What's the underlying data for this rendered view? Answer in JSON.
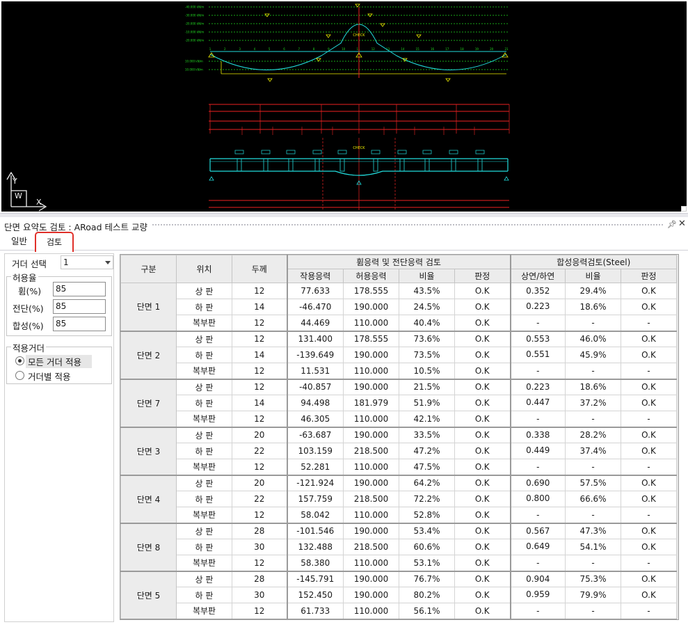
{
  "cad": {
    "loads": [
      "-40.000 kN/m",
      "-30.000 kN/m",
      "-20.000 kN/m",
      "-10.000 kN/m",
      "-20.000 kN/m",
      "10.000 kN/m",
      "10.000 kN/m"
    ],
    "check_top": "CHECK",
    "check_bottom": "CHECK",
    "node_numbers": [
      "1",
      "2",
      "3",
      "4",
      "5",
      "6",
      "7",
      "8",
      "9",
      "10",
      "11",
      "12",
      "13",
      "14",
      "15",
      "16",
      "17",
      "18",
      "19",
      "20",
      "21"
    ],
    "axis_x": "X",
    "axis_y": "Y",
    "axis_w": "W"
  },
  "panel": {
    "title": "단면 요약도 검토 : ARoad 테스트 교량",
    "pin_icon": "pin-icon",
    "close_icon": "close-icon"
  },
  "tabs": [
    {
      "label": "일반",
      "active": false
    },
    {
      "label": "검토",
      "active": true
    }
  ],
  "options": {
    "girder_select_label": "거더 선택",
    "girder_select_value": "1",
    "allow_group_label": "허용율",
    "bending_label": "휨(%)",
    "bending_value": "85",
    "shear_label": "전단(%)",
    "shear_value": "85",
    "composite_label": "합성(%)",
    "composite_value": "85",
    "apply_group_label": "적용거더",
    "radio_all": "모든 거더 적용",
    "radio_each": "거더별 적용",
    "radio_selected": "all"
  },
  "table": {
    "headers": {
      "group": "구분",
      "position": "위치",
      "thickness": "두께",
      "bending_group": "휨응력 및 전단응력 검토",
      "composite_group": "합성응력검토(Steel)",
      "applied_stress": "작용응력",
      "allowable_stress": "허용응력",
      "ratio": "비율",
      "judgement": "판정",
      "upper_lower": "상연/하연",
      "ratio2": "비율",
      "judgement2": "판정"
    },
    "sections": [
      {
        "name": "단면 1",
        "rows": [
          {
            "pos": "상 판",
            "t": "12",
            "applied": "77.633",
            "allow": "178.555",
            "ratio": "43.5%",
            "judge": "O.K",
            "ul": "0.352",
            "ratio2": "29.4%",
            "judge2": "O.K"
          },
          {
            "pos": "하 판",
            "t": "14",
            "applied": "-46.470",
            "allow": "190.000",
            "ratio": "24.5%",
            "judge": "O.K",
            "ul": "0.223",
            "ratio2": "18.6%",
            "judge2": "O.K"
          },
          {
            "pos": "복부판",
            "t": "12",
            "applied": "44.469",
            "allow": "110.000",
            "ratio": "40.4%",
            "judge": "O.K",
            "ul": "-",
            "ratio2": "-",
            "judge2": "-"
          }
        ]
      },
      {
        "name": "단면 2",
        "rows": [
          {
            "pos": "상 판",
            "t": "12",
            "applied": "131.400",
            "allow": "178.555",
            "ratio": "73.6%",
            "judge": "O.K",
            "ul": "0.553",
            "ratio2": "46.0%",
            "judge2": "O.K"
          },
          {
            "pos": "하 판",
            "t": "14",
            "applied": "-139.649",
            "allow": "190.000",
            "ratio": "73.5%",
            "judge": "O.K",
            "ul": "0.551",
            "ratio2": "45.9%",
            "judge2": "O.K"
          },
          {
            "pos": "복부판",
            "t": "12",
            "applied": "11.531",
            "allow": "110.000",
            "ratio": "10.5%",
            "judge": "O.K",
            "ul": "-",
            "ratio2": "-",
            "judge2": "-"
          }
        ]
      },
      {
        "name": "단면 7",
        "rows": [
          {
            "pos": "상 판",
            "t": "12",
            "applied": "-40.857",
            "allow": "190.000",
            "ratio": "21.5%",
            "judge": "O.K",
            "ul": "0.223",
            "ratio2": "18.6%",
            "judge2": "O.K"
          },
          {
            "pos": "하 판",
            "t": "14",
            "applied": "94.498",
            "allow": "181.979",
            "ratio": "51.9%",
            "judge": "O.K",
            "ul": "0.447",
            "ratio2": "37.2%",
            "judge2": "O.K"
          },
          {
            "pos": "복부판",
            "t": "12",
            "applied": "46.305",
            "allow": "110.000",
            "ratio": "42.1%",
            "judge": "O.K",
            "ul": "-",
            "ratio2": "-",
            "judge2": "-"
          }
        ]
      },
      {
        "name": "단면 3",
        "rows": [
          {
            "pos": "상 판",
            "t": "20",
            "applied": "-63.687",
            "allow": "190.000",
            "ratio": "33.5%",
            "judge": "O.K",
            "ul": "0.338",
            "ratio2": "28.2%",
            "judge2": "O.K"
          },
          {
            "pos": "하 판",
            "t": "22",
            "applied": "103.159",
            "allow": "218.500",
            "ratio": "47.2%",
            "judge": "O.K",
            "ul": "0.449",
            "ratio2": "37.4%",
            "judge2": "O.K"
          },
          {
            "pos": "복부판",
            "t": "12",
            "applied": "52.281",
            "allow": "110.000",
            "ratio": "47.5%",
            "judge": "O.K",
            "ul": "-",
            "ratio2": "-",
            "judge2": "-"
          }
        ]
      },
      {
        "name": "단면 4",
        "rows": [
          {
            "pos": "상 판",
            "t": "20",
            "applied": "-121.924",
            "allow": "190.000",
            "ratio": "64.2%",
            "judge": "O.K",
            "ul": "0.690",
            "ratio2": "57.5%",
            "judge2": "O.K"
          },
          {
            "pos": "하 판",
            "t": "22",
            "applied": "157.759",
            "allow": "218.500",
            "ratio": "72.2%",
            "judge": "O.K",
            "ul": "0.800",
            "ratio2": "66.6%",
            "judge2": "O.K"
          },
          {
            "pos": "복부판",
            "t": "12",
            "applied": "58.042",
            "allow": "110.000",
            "ratio": "52.8%",
            "judge": "O.K",
            "ul": "-",
            "ratio2": "-",
            "judge2": "-"
          }
        ]
      },
      {
        "name": "단면 8",
        "rows": [
          {
            "pos": "상 판",
            "t": "28",
            "applied": "-101.546",
            "allow": "190.000",
            "ratio": "53.4%",
            "judge": "O.K",
            "ul": "0.567",
            "ratio2": "47.3%",
            "judge2": "O.K"
          },
          {
            "pos": "하 판",
            "t": "30",
            "applied": "132.488",
            "allow": "218.500",
            "ratio": "60.6%",
            "judge": "O.K",
            "ul": "0.649",
            "ratio2": "54.1%",
            "judge2": "O.K"
          },
          {
            "pos": "복부판",
            "t": "12",
            "applied": "58.380",
            "allow": "110.000",
            "ratio": "53.1%",
            "judge": "O.K",
            "ul": "-",
            "ratio2": "-",
            "judge2": "-"
          }
        ]
      },
      {
        "name": "단면 5",
        "rows": [
          {
            "pos": "상 판",
            "t": "28",
            "applied": "-145.791",
            "allow": "190.000",
            "ratio": "76.7%",
            "judge": "O.K",
            "ul": "0.904",
            "ratio2": "75.3%",
            "judge2": "O.K"
          },
          {
            "pos": "하 판",
            "t": "30",
            "applied": "152.450",
            "allow": "190.000",
            "ratio": "80.2%",
            "judge": "O.K",
            "ul": "0.959",
            "ratio2": "79.9%",
            "judge2": "O.K"
          },
          {
            "pos": "복부판",
            "t": "12",
            "applied": "61.733",
            "allow": "110.000",
            "ratio": "56.1%",
            "judge": "O.K",
            "ul": "-",
            "ratio2": "-",
            "judge2": "-"
          }
        ]
      }
    ]
  },
  "colors": {
    "cad_background": "#000000",
    "cad_green": "#22dd22",
    "cad_cyan": "#22dddd",
    "cad_yellow": "#eeee00",
    "cad_red": "#ee2222",
    "tab_highlight": "#e0302a"
  }
}
